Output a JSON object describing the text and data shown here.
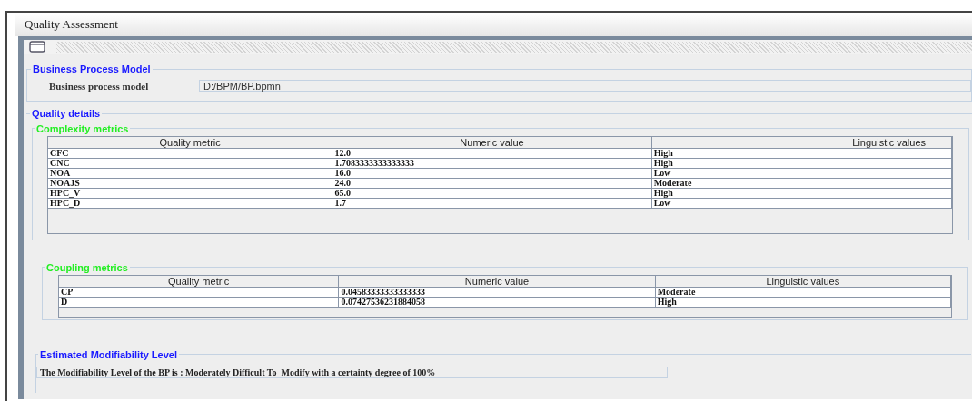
{
  "window": {
    "title": "Quality Assessment"
  },
  "business_process_model": {
    "title": "Business Process Model",
    "label": "Business process model",
    "value": "D:/BPM/BP.bpmn"
  },
  "quality_details": {
    "title": "Quality details",
    "tables": [
      {
        "title": "Complexity metrics",
        "columns": [
          "Quality metric",
          "Numeric value",
          "Linguistic values"
        ],
        "rows": [
          [
            "CFC",
            "12.0",
            "High"
          ],
          [
            "CNC",
            "1.7083333333333333",
            "High"
          ],
          [
            "NOA",
            "16.0",
            "Low"
          ],
          [
            "NOAJS",
            "24.0",
            "Moderate"
          ],
          [
            "HPC_V",
            "65.0",
            "High"
          ],
          [
            "HPC_D",
            "1.7",
            "Low"
          ]
        ]
      },
      {
        "title": "Coupling metrics",
        "columns": [
          "Quality metric",
          "Numeric value",
          "Linguistic values"
        ],
        "rows": [
          [
            "CP",
            "0.04583333333333333",
            "Moderate"
          ],
          [
            "D",
            "0.07427536231884058",
            "High"
          ]
        ]
      }
    ]
  },
  "estimated_level": {
    "title": "Estimated Modifiability Level",
    "message": "The Modifiability Level of the BP is : Moderately Difficult To  Modify with a certainty degree of 100%"
  }
}
